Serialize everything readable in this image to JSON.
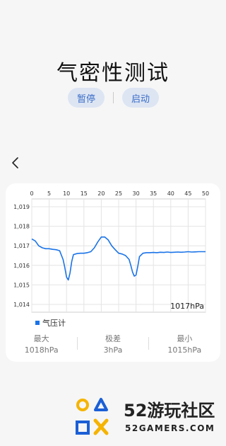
{
  "title": "气密性测试",
  "controls": {
    "pause_label": "暂停",
    "start_label": "启动"
  },
  "chart_data": {
    "type": "line",
    "x_ticks": [
      "0",
      "5",
      "10",
      "15",
      "20",
      "25",
      "30",
      "35",
      "40",
      "45",
      "50"
    ],
    "y_ticks": [
      "1,019",
      "1,018",
      "1,017",
      "1,016",
      "1,015",
      "1,014"
    ],
    "xlim": [
      0,
      50
    ],
    "ylim": [
      1013.6,
      1019.4
    ],
    "series": [
      {
        "name": "气压计",
        "color": "#1a73e8",
        "x": [
          0,
          1,
          2,
          3,
          4,
          5,
          6,
          7,
          8,
          9,
          9.5,
          10,
          10.5,
          11,
          11.5,
          12,
          13,
          14,
          15,
          16,
          17,
          18,
          19,
          20,
          21,
          22,
          23,
          24,
          25,
          26,
          27,
          28,
          28.5,
          29,
          29.5,
          30,
          30.5,
          31,
          32,
          33,
          34,
          35,
          36,
          37,
          38,
          39,
          40,
          41,
          42,
          43,
          44,
          45,
          46,
          47,
          48,
          49,
          50
        ],
        "values": [
          1017.35,
          1017.25,
          1017.0,
          1016.9,
          1016.85,
          1016.85,
          1016.82,
          1016.8,
          1016.75,
          1016.3,
          1015.9,
          1015.4,
          1015.25,
          1015.6,
          1016.2,
          1016.55,
          1016.6,
          1016.62,
          1016.62,
          1016.65,
          1016.7,
          1016.9,
          1017.2,
          1017.45,
          1017.45,
          1017.3,
          1017.0,
          1016.8,
          1016.62,
          1016.58,
          1016.5,
          1016.3,
          1016.0,
          1015.65,
          1015.45,
          1015.5,
          1015.95,
          1016.45,
          1016.62,
          1016.65,
          1016.65,
          1016.66,
          1016.65,
          1016.67,
          1016.66,
          1016.68,
          1016.66,
          1016.67,
          1016.68,
          1016.67,
          1016.68,
          1016.7,
          1016.68,
          1016.69,
          1016.7,
          1016.7,
          1016.7
        ]
      }
    ],
    "current_reading": "1017hPa",
    "grid": true,
    "legend": "bottom-left"
  },
  "stats": [
    {
      "label": "最大",
      "value": "1018hPa"
    },
    {
      "label": "极差",
      "value": "3hPa"
    },
    {
      "label": "最小",
      "value": "1015hPa"
    }
  ],
  "watermark": {
    "text": "52游玩社区",
    "subtext": "52GAMERS.COM"
  }
}
